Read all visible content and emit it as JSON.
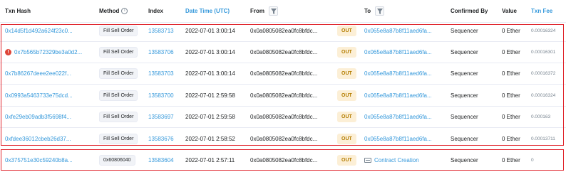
{
  "columns": {
    "txn_hash": "Txn Hash",
    "method": "Method",
    "index": "Index",
    "date_time": "Date Time (UTC)",
    "from": "From",
    "to": "To",
    "confirmed_by": "Confirmed By",
    "value": "Value",
    "txn_fee": "Txn Fee"
  },
  "rows": [
    {
      "hash": "0x14d5f1d492a624f23c0...",
      "method": "Fill Sell Order",
      "index": "13583713",
      "date": "2022-07-01 3:00:14",
      "from": "0x0a0805082ea0fc8bfdc...",
      "direction": "OUT",
      "to": "0x065e8a87b8f11aed6fa...",
      "confirmed_by": "Sequencer",
      "value": "0 Ether",
      "fee": "0.00016324",
      "error": false
    },
    {
      "hash": "0x7b565b72329be3a0d2...",
      "method": "Fill Sell Order",
      "index": "13583706",
      "date": "2022-07-01 3:00:14",
      "from": "0x0a0805082ea0fc8bfdc...",
      "direction": "OUT",
      "to": "0x065e8a87b8f11aed6fa...",
      "confirmed_by": "Sequencer",
      "value": "0 Ether",
      "fee": "0.00016301",
      "error": true
    },
    {
      "hash": "0x7b86267deee2ee022f...",
      "method": "Fill Sell Order",
      "index": "13583703",
      "date": "2022-07-01 3:00:14",
      "from": "0x0a0805082ea0fc8bfdc...",
      "direction": "OUT",
      "to": "0x065e8a87b8f11aed6fa...",
      "confirmed_by": "Sequencer",
      "value": "0 Ether",
      "fee": "0.00016372",
      "error": false
    },
    {
      "hash": "0x0993a5463733e75dcd...",
      "method": "Fill Sell Order",
      "index": "13583700",
      "date": "2022-07-01 2:59:58",
      "from": "0x0a0805082ea0fc8bfdc...",
      "direction": "OUT",
      "to": "0x065e8a87b8f11aed6fa...",
      "confirmed_by": "Sequencer",
      "value": "0 Ether",
      "fee": "0.00016324",
      "error": false
    },
    {
      "hash": "0xfe29eb09adb3f5698f4...",
      "method": "Fill Sell Order",
      "index": "13583697",
      "date": "2022-07-01 2:59:58",
      "from": "0x0a0805082ea0fc8bfdc...",
      "direction": "OUT",
      "to": "0x065e8a87b8f11aed6fa...",
      "confirmed_by": "Sequencer",
      "value": "0 Ether",
      "fee": "0.000163",
      "error": false
    },
    {
      "hash": "0xfdee36012cbeb26d37...",
      "method": "Fill Sell Order",
      "index": "13583676",
      "date": "2022-07-01 2:58:52",
      "from": "0x0a0805082ea0fc8bfdc...",
      "direction": "OUT",
      "to": "0x065e8a87b8f11aed6fa...",
      "confirmed_by": "Sequencer",
      "value": "0 Ether",
      "fee": "0.00013711",
      "error": false
    },
    {
      "hash": "0x375751e30c59240b8a...",
      "method": "0x60806040",
      "index": "13583604",
      "date": "2022-07-01 2:57:11",
      "from": "0x0a0805082ea0fc8bfdc...",
      "direction": "OUT",
      "to": "Contract Creation",
      "confirmed_by": "Sequencer",
      "value": "0 Ether",
      "fee": "0",
      "error": false,
      "to_is_contract": true
    }
  ],
  "colors": {
    "link": "#3498db",
    "highlight_border": "#e0242c",
    "out_badge_bg": "#fcefd6",
    "out_badge_text": "#b47d00",
    "error": "#de4437"
  },
  "icons": {
    "method_info": "info-circle-icon",
    "filter": "filter-icon",
    "error": "exclamation-circle-icon",
    "contract": "contract-creation-icon"
  }
}
